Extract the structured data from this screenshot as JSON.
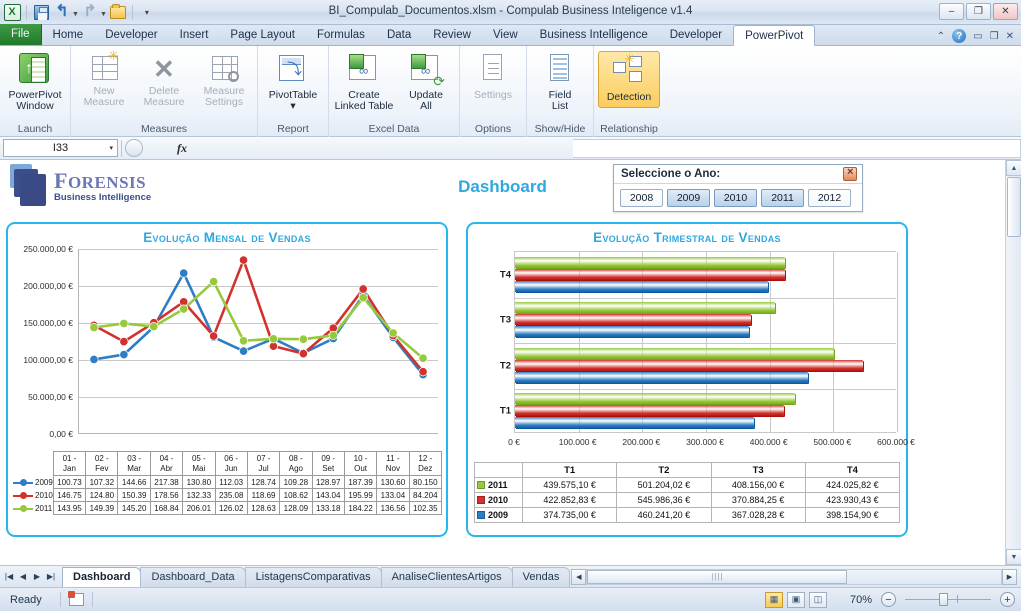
{
  "window": {
    "title": "BI_Compulab_Documentos.xlsm  -  Compulab Business Inteligence v1.4",
    "minimize": "–",
    "restore": "❐",
    "close": "✕",
    "help_icon": "?",
    "collapse_ribbon_icon": "⌃"
  },
  "quick_access": {
    "app_logo": "X",
    "save": "save-icon",
    "undo": "↰",
    "redo": "↱",
    "open": "open-icon",
    "customize": "▾"
  },
  "ribbon": {
    "tabs": [
      {
        "label": "File",
        "active": false,
        "is_file": true
      },
      {
        "label": "Home",
        "active": false
      },
      {
        "label": "Developer",
        "active": false
      },
      {
        "label": "Insert",
        "active": false
      },
      {
        "label": "Page Layout",
        "active": false
      },
      {
        "label": "Formulas",
        "active": false
      },
      {
        "label": "Data",
        "active": false
      },
      {
        "label": "Review",
        "active": false
      },
      {
        "label": "View",
        "active": false
      },
      {
        "label": "Business Intelligence",
        "active": false
      },
      {
        "label": "Developer",
        "active": false
      },
      {
        "label": "PowerPivot",
        "active": true
      }
    ],
    "groups": [
      {
        "label": "Launch",
        "buttons": [
          {
            "line1": "PowerPivot",
            "line2": "Window",
            "icon": "powerpivot-window-icon",
            "state": "normal"
          }
        ]
      },
      {
        "label": "Measures",
        "buttons": [
          {
            "line1": "New",
            "line2": "Measure",
            "icon": "new-measure-icon",
            "state": "disabled"
          },
          {
            "line1": "Delete",
            "line2": "Measure",
            "icon": "delete-measure-icon",
            "state": "disabled"
          },
          {
            "line1": "Measure",
            "line2": "Settings",
            "icon": "measure-settings-icon",
            "state": "disabled"
          }
        ]
      },
      {
        "label": "Report",
        "buttons": [
          {
            "line1": "PivotTable",
            "line2": "▾",
            "icon": "pivottable-icon",
            "state": "normal"
          }
        ]
      },
      {
        "label": "Excel Data",
        "buttons": [
          {
            "line1": "Create",
            "line2": "Linked Table",
            "icon": "create-linked-table-icon",
            "state": "normal"
          },
          {
            "line1": "Update",
            "line2": "All",
            "icon": "update-all-icon",
            "state": "normal"
          }
        ]
      },
      {
        "label": "Options",
        "buttons": [
          {
            "line1": "Settings",
            "line2": "",
            "icon": "settings-icon",
            "state": "disabled"
          }
        ]
      },
      {
        "label": "Show/Hide",
        "buttons": [
          {
            "line1": "Field",
            "line2": "List",
            "icon": "field-list-icon",
            "state": "normal"
          }
        ]
      },
      {
        "label": "Relationship",
        "buttons": [
          {
            "line1": "Detection",
            "line2": "",
            "icon": "detection-icon",
            "state": "selected"
          }
        ]
      }
    ]
  },
  "formula_bar": {
    "name_box_value": "I33",
    "name_box_arrow": "▾",
    "insert_function_label": "fx",
    "formula_value": ""
  },
  "banner": {
    "brand_cap": "F",
    "brand_rest": "ORENSIS",
    "brand_sub": "Business Intelligence",
    "dashboard_title": "Dashboard"
  },
  "slicer": {
    "title": "Seleccione o Ano:",
    "clear_filter_icon": "clear-filter-icon",
    "items": [
      {
        "label": "2008",
        "selected": false
      },
      {
        "label": "2009",
        "selected": true
      },
      {
        "label": "2010",
        "selected": true
      },
      {
        "label": "2011",
        "selected": true
      },
      {
        "label": "2012",
        "selected": false
      }
    ]
  },
  "colors": {
    "series_2009": "#2f7ec4",
    "series_2010": "#d2322d",
    "series_2011": "#97c93d",
    "accent": "#29b6ef",
    "title_blue": "#2ea8e0"
  },
  "chart_data": [
    {
      "type": "line",
      "panel": "left",
      "title": "Evolução Mensal de Vendas",
      "xlabel": "",
      "ylabel": "",
      "ylim": [
        0,
        250000
      ],
      "grid": true,
      "legend_position": "table-left",
      "ytick_labels": [
        "0,00 €",
        "50.000,00 €",
        "100.000,00 €",
        "150.000,00 €",
        "200.000,00 €",
        "250.000,00 €"
      ],
      "ytick_values": [
        0,
        50000,
        100000,
        150000,
        200000,
        250000
      ],
      "categories": [
        "01 - Jan",
        "02 - Fev",
        "03 - Mar",
        "04 - Abr",
        "05 - Mai",
        "06 - Jun",
        "07 - Jul",
        "08 - Ago",
        "09 - Set",
        "10 - Out",
        "11 - Nov",
        "12 - Dez"
      ],
      "categories_l1": [
        "01 -",
        "02 -",
        "03 -",
        "04 -",
        "05 -",
        "06 -",
        "07 -",
        "08 -",
        "09 -",
        "10 -",
        "11 -",
        "12 -"
      ],
      "categories_l2": [
        "Jan",
        "Fev",
        "Mar",
        "Abr",
        "Mai",
        "Jun",
        "Jul",
        "Ago",
        "Set",
        "Out",
        "Nov",
        "Dez"
      ],
      "series": [
        {
          "name": "2009",
          "color": "#2f7ec4",
          "labels": [
            "100.73",
            "107.32",
            "144.66",
            "217.38",
            "130.80",
            "112.03",
            "128.74",
            "109.28",
            "128.97",
            "187.39",
            "130.60",
            "80.150"
          ],
          "values": [
            100730,
            107320,
            144660,
            217380,
            130800,
            112030,
            128740,
            109280,
            128970,
            187390,
            130600,
            80150
          ]
        },
        {
          "name": "2010",
          "color": "#d2322d",
          "labels": [
            "146.75",
            "124.80",
            "150.39",
            "178.56",
            "132.33",
            "235.08",
            "118.69",
            "108.62",
            "143.04",
            "195.99",
            "133.04",
            "84.204"
          ],
          "values": [
            146750,
            124800,
            150390,
            178560,
            132330,
            235080,
            118690,
            108620,
            143040,
            195990,
            133040,
            84204
          ]
        },
        {
          "name": "2011",
          "color": "#97c93d",
          "labels": [
            "143.95",
            "149.39",
            "145.20",
            "168.84",
            "206.01",
            "126.02",
            "128.63",
            "128.09",
            "133.18",
            "184.22",
            "136.56",
            "102.35"
          ],
          "values": [
            143950,
            149390,
            145200,
            168840,
            206010,
            126020,
            128630,
            128090,
            133180,
            184220,
            136560,
            102350
          ]
        }
      ]
    },
    {
      "type": "bar",
      "orientation": "horizontal",
      "panel": "right",
      "title": "Evolução Trimestral  de Vendas",
      "xlabel": "",
      "ylabel": "",
      "xlim": [
        0,
        600000
      ],
      "grid": true,
      "legend_position": "table-left",
      "xtick_labels": [
        "0 €",
        "100.000 €",
        "200.000 €",
        "300.000 €",
        "400.000 €",
        "500.000 €",
        "600.000 €"
      ],
      "xtick_values": [
        0,
        100000,
        200000,
        300000,
        400000,
        500000,
        600000
      ],
      "categories": [
        "T1",
        "T2",
        "T3",
        "T4"
      ],
      "series": [
        {
          "name": "2009",
          "color": "#2f7ec4",
          "labels": [
            "374.735,00 €",
            "460.241,20 €",
            "367.028,28 €",
            "398.154,90 €"
          ],
          "values": [
            374735.0,
            460241.2,
            367028.28,
            398154.9
          ]
        },
        {
          "name": "2010",
          "color": "#d2322d",
          "labels": [
            "422.852,83 €",
            "545.986,36 €",
            "370.884,25 €",
            "423.930,43 €"
          ],
          "values": [
            422852.83,
            545986.36,
            370884.25,
            423930.43
          ]
        },
        {
          "name": "2011",
          "color": "#97c93d",
          "labels": [
            "439.575,10 €",
            "501.204,02 €",
            "408.156,00 €",
            "424.025,82 €"
          ],
          "values": [
            439575.1,
            501204.02,
            408156.0,
            424025.82
          ]
        }
      ]
    }
  ],
  "monthly_table": {
    "corner": "",
    "row_order": [
      "2009",
      "2010",
      "2011"
    ]
  },
  "quarter_table": {
    "corner": "",
    "headers": [
      "T1",
      "T2",
      "T3",
      "T4"
    ],
    "rows": [
      {
        "year": "2011",
        "color": "#97c93d",
        "values": [
          "439.575,10 €",
          "501.204,02 €",
          "408.156,00 €",
          "424.025,82 €"
        ]
      },
      {
        "year": "2010",
        "color": "#d2322d",
        "values": [
          "422.852,83 €",
          "545.986,36 €",
          "370.884,25 €",
          "423.930,43 €"
        ]
      },
      {
        "year": "2009",
        "color": "#2f7ec4",
        "values": [
          "374.735,00 €",
          "460.241,20 €",
          "367.028,28 €",
          "398.154,90 €"
        ]
      }
    ]
  },
  "sheet_tabs": {
    "nav_first": "|◀",
    "nav_prev": "◀",
    "nav_next": "▶",
    "nav_last": "▶|",
    "tabs": [
      {
        "label": "Dashboard",
        "active": true
      },
      {
        "label": "Dashboard_Data",
        "active": false
      },
      {
        "label": "ListagensComparativas",
        "active": false
      },
      {
        "label": "AnaliseClientesArtigos",
        "active": false
      },
      {
        "label": "Vendas",
        "active": false
      }
    ]
  },
  "status_bar": {
    "state": "Ready",
    "macro_record_icon": "macro-record-icon",
    "view_normal": "normal-view-icon",
    "view_layout": "page-layout-view-icon",
    "view_break": "page-break-view-icon",
    "zoom_level": "70%",
    "zoom_out": "−",
    "zoom_in": "+"
  }
}
